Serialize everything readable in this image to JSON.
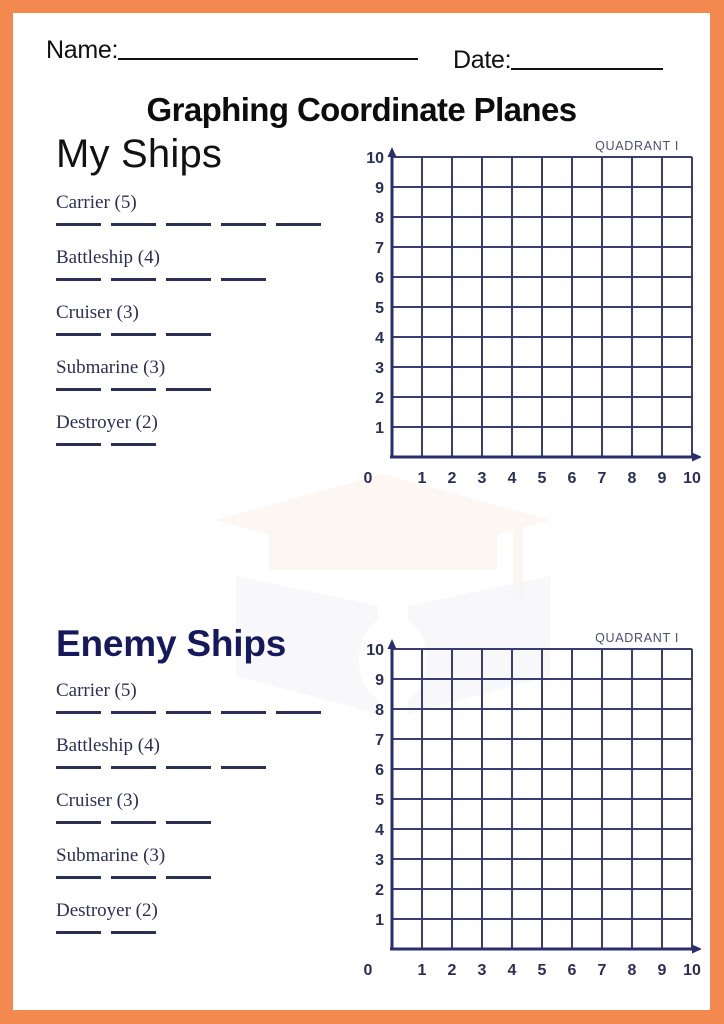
{
  "page": {
    "border_color": "#F4894F",
    "background_color": "#FFFFFF",
    "title": "Graphing Coordinate Planes"
  },
  "header": {
    "name_label": "Name:",
    "name_value": "",
    "date_label": "Date:",
    "date_value": ""
  },
  "sections": [
    {
      "id": "my-ships",
      "heading": "My Ships",
      "heading_style": "thin-black",
      "ships": [
        {
          "label": "Carrier (5)",
          "size": 5
        },
        {
          "label": "Battleship (4)",
          "size": 4
        },
        {
          "label": "Cruiser (3)",
          "size": 3
        },
        {
          "label": "Submarine (3)",
          "size": 3
        },
        {
          "label": "Destroyer (2)",
          "size": 2
        }
      ],
      "grid": {
        "quadrant_label": "QUADRANT I",
        "x_ticks": [
          "0",
          "1",
          "2",
          "3",
          "4",
          "5",
          "6",
          "7",
          "8",
          "9",
          "10"
        ],
        "y_ticks": [
          "1",
          "2",
          "3",
          "4",
          "5",
          "6",
          "7",
          "8",
          "9",
          "10"
        ]
      }
    },
    {
      "id": "enemy-ships",
      "heading": "Enemy Ships",
      "heading_style": "bold-navy",
      "ships": [
        {
          "label": "Carrier (5)",
          "size": 5
        },
        {
          "label": "Battleship (4)",
          "size": 4
        },
        {
          "label": "Cruiser (3)",
          "size": 3
        },
        {
          "label": "Submarine (3)",
          "size": 3
        },
        {
          "label": "Destroyer (2)",
          "size": 2
        }
      ],
      "grid": {
        "quadrant_label": "QUADRANT I",
        "x_ticks": [
          "0",
          "1",
          "2",
          "3",
          "4",
          "5",
          "6",
          "7",
          "8",
          "9",
          "10"
        ],
        "y_ticks": [
          "1",
          "2",
          "3",
          "4",
          "5",
          "6",
          "7",
          "8",
          "9",
          "10"
        ]
      }
    }
  ],
  "chart_data": {
    "type": "scatter",
    "title": "Graphing Coordinate Planes",
    "plots": [
      {
        "name": "My Ships",
        "quadrant": "QUADRANT I",
        "xlabel": "",
        "ylabel": "",
        "xlim": [
          0,
          10
        ],
        "ylim": [
          0,
          10
        ],
        "xticks": [
          0,
          1,
          2,
          3,
          4,
          5,
          6,
          7,
          8,
          9,
          10
        ],
        "yticks": [
          1,
          2,
          3,
          4,
          5,
          6,
          7,
          8,
          9,
          10
        ],
        "grid": true,
        "grid_cells": [
          10,
          10
        ],
        "series": [],
        "points": []
      },
      {
        "name": "Enemy Ships",
        "quadrant": "QUADRANT I",
        "xlabel": "",
        "ylabel": "",
        "xlim": [
          0,
          10
        ],
        "ylim": [
          0,
          10
        ],
        "xticks": [
          0,
          1,
          2,
          3,
          4,
          5,
          6,
          7,
          8,
          9,
          10
        ],
        "yticks": [
          1,
          2,
          3,
          4,
          5,
          6,
          7,
          8,
          9,
          10
        ],
        "grid": true,
        "grid_cells": [
          10,
          10
        ],
        "series": [],
        "points": []
      }
    ],
    "colors": {
      "axis": "#2B2E6E",
      "grid": "#3A3D73",
      "tick_text": "#2B2E55"
    }
  }
}
